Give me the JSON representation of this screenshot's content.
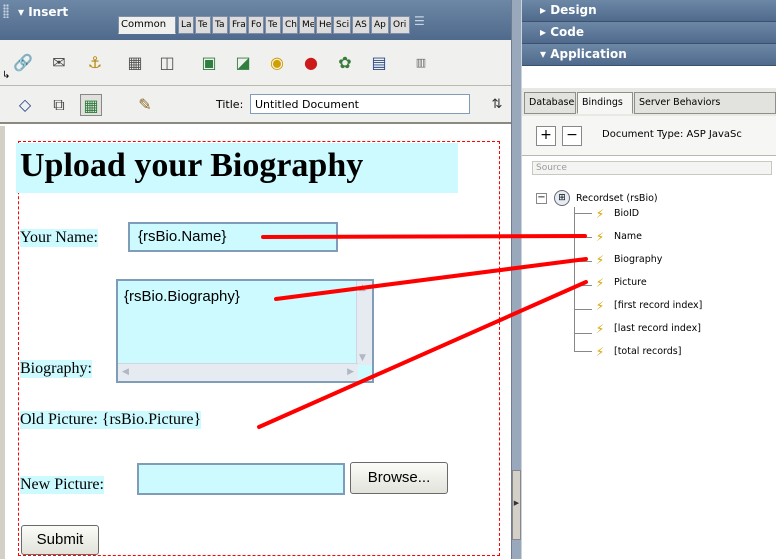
{
  "insert_panel": {
    "title": "Insert",
    "tabs": [
      "Common",
      "La",
      "Te",
      "Ta",
      "Fra",
      "Fo",
      "Te",
      "Ch",
      "Me",
      "He",
      "Sci",
      "AS",
      "Ap",
      "Ori"
    ],
    "icons": [
      "hyperlink-icon",
      "email-icon",
      "anchor-icon",
      "table-icon",
      "layer-icon",
      "image-icon",
      "image-placeholder-icon",
      "flash-icon",
      "shockwave-icon",
      "rollover-icon",
      "navbar-icon",
      "date-icon"
    ]
  },
  "doc_toolbar": {
    "title_label": "Title:",
    "title_value": "Untitled Document"
  },
  "design_view": {
    "heading": "Upload your Biography",
    "name_label": "Your Name:",
    "name_value": "{rsBio.Name}",
    "biography_label": "Biography:",
    "biography_value": "{rsBio.Biography}",
    "old_picture_label": "Old Picture:",
    "old_picture_value": "{rsBio.Picture}",
    "new_picture_label": "New Picture:",
    "browse_label": "Browse...",
    "submit_label": "Submit"
  },
  "right_panels": {
    "design": "Design",
    "code": "Code",
    "application": "Application",
    "tabs": [
      "Databases",
      "Bindings",
      "Server Behaviors"
    ],
    "add_symbol": "+",
    "remove_symbol": "−",
    "doc_type": "Document Type: ASP JavaSc",
    "column_header": "Source",
    "recordset": "Recordset (rsBio)",
    "fields": [
      "BioID",
      "Name",
      "Biography",
      "Picture",
      "[first record index]",
      "[last record index]",
      "[total records]"
    ]
  },
  "colors": {
    "panel_header": "#5b7596",
    "dynamic_tint": "#ccfaff",
    "connector": "#ff0000",
    "form_border": "#ff0000"
  }
}
